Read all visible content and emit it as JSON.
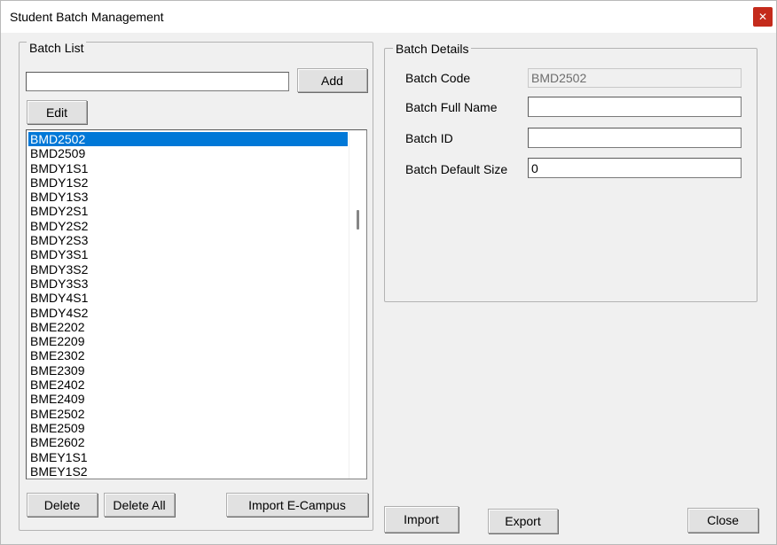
{
  "window": {
    "title": "Student Batch Management",
    "close_glyph": "✕"
  },
  "batch_list": {
    "group_label": "Batch List",
    "search_value": "",
    "add_label": "Add",
    "edit_label": "Edit",
    "items": [
      "BMD2502",
      "BMD2509",
      "BMDY1S1",
      "BMDY1S2",
      "BMDY1S3",
      "BMDY2S1",
      "BMDY2S2",
      "BMDY2S3",
      "BMDY3S1",
      "BMDY3S2",
      "BMDY3S3",
      "BMDY4S1",
      "BMDY4S2",
      "BME2202",
      "BME2209",
      "BME2302",
      "BME2309",
      "BME2402",
      "BME2409",
      "BME2502",
      "BME2509",
      "BME2602",
      "BMEY1S1",
      "BMEY1S2"
    ],
    "selected_index": 0,
    "delete_label": "Delete",
    "delete_all_label": "Delete All",
    "import_ecampus_label": "Import E-Campus"
  },
  "batch_details": {
    "group_label": "Batch Details",
    "code_label": "Batch Code",
    "code_value": "BMD2502",
    "full_name_label": "Batch Full Name",
    "full_name_value": "",
    "id_label": "Batch ID",
    "id_value": "",
    "default_size_label": "Batch Default Size",
    "default_size_value": "0"
  },
  "footer": {
    "import_label": "Import",
    "export_label": "Export",
    "close_label": "Close"
  },
  "colors": {
    "selection": "#0078d7",
    "close_button": "#c42b1c"
  }
}
